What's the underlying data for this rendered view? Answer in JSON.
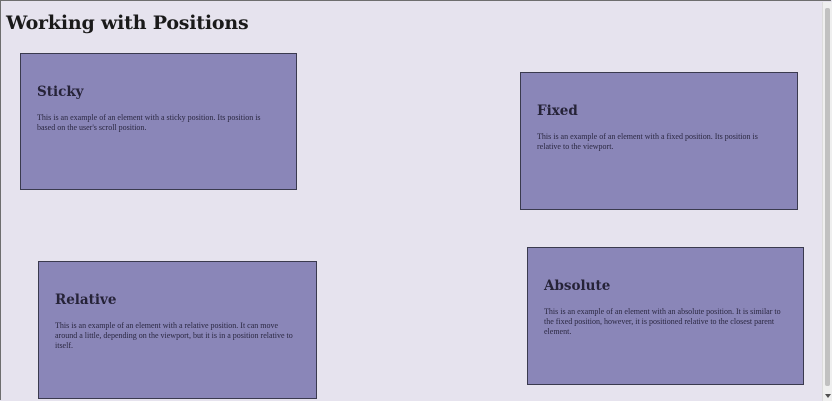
{
  "page": {
    "title": "Working with Positions"
  },
  "boxes": {
    "sticky": {
      "heading": "Sticky",
      "text": "This is an example of an element with a sticky position. Its position is based on the user's scroll position."
    },
    "fixed": {
      "heading": "Fixed",
      "text": "This is an example of an element with a fixed position. Its position is relative to the viewport."
    },
    "relative": {
      "heading": "Relative",
      "text": "This is an example of an element with a relative position. It can move around a little, depending on the viewport, but it is in a position relative to itself."
    },
    "absolute": {
      "heading": "Absolute",
      "text": "This is an example of an element with an absolute position. It is similar to the fixed position, however, it is positioned relative to the closest parent element."
    }
  },
  "colors": {
    "background": "#e6e3ee",
    "box_fill": "#8a86b8",
    "box_border": "#3a3a4e"
  },
  "icons": {
    "scroll_down": "chevron-down-icon"
  }
}
